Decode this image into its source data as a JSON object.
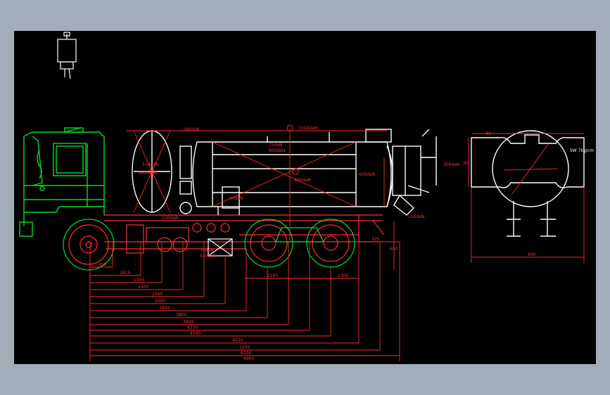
{
  "colors": {
    "background": "#000000",
    "frame": "#a3acb9",
    "dimension": "#ff2a2a",
    "cab": "#00e020",
    "body": "#ffffff",
    "chassis": "#ff3030"
  },
  "icons": [
    "ucs-icon"
  ],
  "annotations": {
    "top_load": "1500daN",
    "cab_load": "150daN",
    "cab_pos": "160daN",
    "cab_val": "1600daN",
    "tank_top": "75daN",
    "tank_mid": "800daN",
    "tank_center": "400daN",
    "tank_right": "600daN",
    "rear_right": "300daN",
    "left_bottom": "40daN",
    "left_under": "200daN",
    "chassis_a": "75daN",
    "chassis_b": "540daN",
    "rear_small": "150daN",
    "side_note": "SW 7kg/cm"
  },
  "dimensions": {
    "d1": "950",
    "d2": "1815",
    "d3": "1300",
    "d4": "2400",
    "d5": "2560",
    "d6": "2600",
    "d7": "2950",
    "d8": "3800",
    "d9": "3900",
    "d10": "4230",
    "d11": "4390",
    "d12": "4630",
    "d13": "5200",
    "d14": "6100",
    "d15": "6900",
    "axle_a": "1165",
    "axle_b": "1300",
    "rear_a": "320",
    "rear_h": "650",
    "end_width": "800",
    "end_top": "40",
    "end_side": "50"
  }
}
